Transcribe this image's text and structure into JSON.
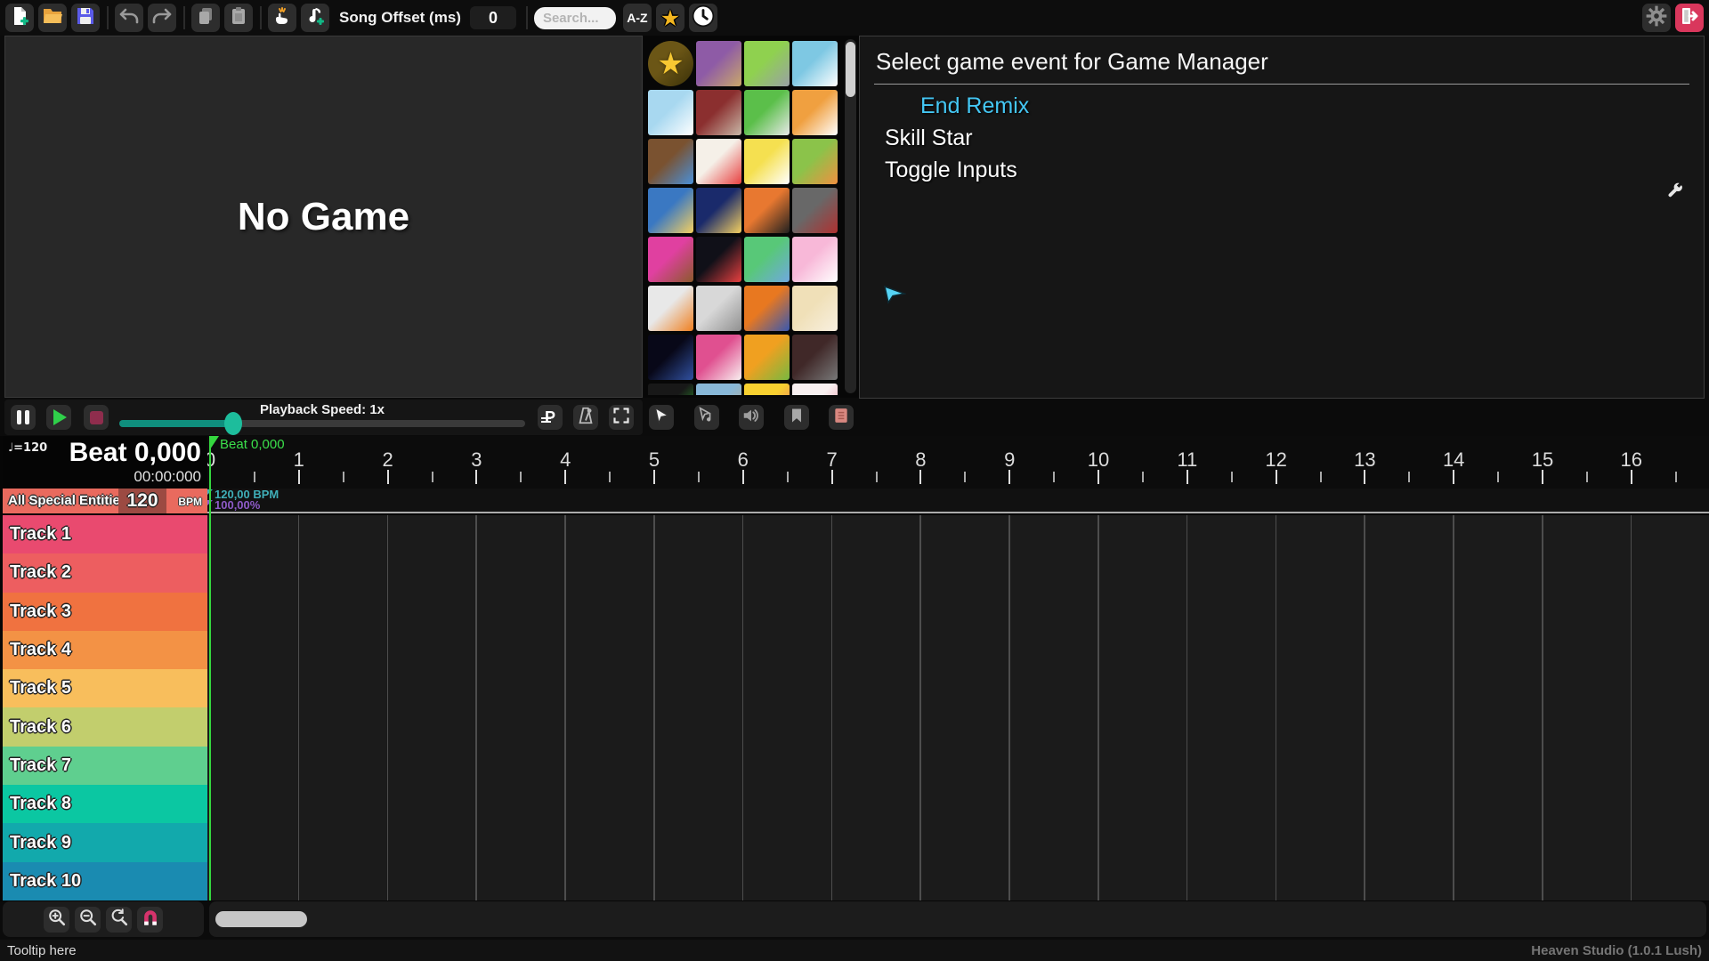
{
  "toolbar": {
    "song_offset_label": "Song Offset (ms)",
    "song_offset_value": "0",
    "search_placeholder": "Search...",
    "az_label": "A-Z",
    "star_glyph": "★"
  },
  "preview": {
    "no_game_label": "No Game"
  },
  "game_grid": {
    "selected_icon_glyph": "★",
    "icons": [
      {
        "name": "game-manager",
        "circle": true,
        "colors": [
          "#6B5616",
          "#3A3008"
        ],
        "star": true
      },
      {
        "name": "game-2",
        "colors": [
          "#8E5BA6",
          "#C9A86A"
        ]
      },
      {
        "name": "game-3",
        "colors": [
          "#8FD14F",
          "#9AA0A6"
        ]
      },
      {
        "name": "game-4",
        "colors": [
          "#7EC8E3",
          "#FFFFFF"
        ]
      },
      {
        "name": "game-5",
        "colors": [
          "#A8D8F0",
          "#FFFFFF"
        ]
      },
      {
        "name": "game-6",
        "colors": [
          "#8B2F2F",
          "#C8B8A8"
        ]
      },
      {
        "name": "game-7",
        "colors": [
          "#5BBF4A",
          "#E8E8E8"
        ]
      },
      {
        "name": "game-8",
        "colors": [
          "#F0A040",
          "#FFFFFF"
        ]
      },
      {
        "name": "game-9",
        "colors": [
          "#7A5230",
          "#4A90D9"
        ]
      },
      {
        "name": "game-10",
        "colors": [
          "#F5F0E8",
          "#E84040"
        ]
      },
      {
        "name": "game-11",
        "colors": [
          "#F5E050",
          "#FFFFFF"
        ]
      },
      {
        "name": "game-12",
        "colors": [
          "#8BC34A",
          "#F09040"
        ]
      },
      {
        "name": "game-13",
        "colors": [
          "#3A78C2",
          "#F5D060"
        ]
      },
      {
        "name": "game-14",
        "colors": [
          "#1A2A6B",
          "#F5D060"
        ]
      },
      {
        "name": "game-15",
        "colors": [
          "#E87830",
          "#202020"
        ]
      },
      {
        "name": "game-16",
        "colors": [
          "#686868",
          "#B03030"
        ]
      },
      {
        "name": "game-17",
        "colors": [
          "#E040A0",
          "#8B5A2B"
        ]
      },
      {
        "name": "game-18",
        "colors": [
          "#101018",
          "#E84040"
        ]
      },
      {
        "name": "game-19",
        "colors": [
          "#58C878",
          "#70A8E0"
        ]
      },
      {
        "name": "game-20",
        "colors": [
          "#F8B8D8",
          "#FFFFFF"
        ]
      },
      {
        "name": "game-21",
        "colors": [
          "#E8E8E8",
          "#F08020"
        ]
      },
      {
        "name": "game-22",
        "colors": [
          "#D8D8D8",
          "#909090"
        ]
      },
      {
        "name": "game-23",
        "colors": [
          "#E87820",
          "#3858B0"
        ]
      },
      {
        "name": "game-24",
        "colors": [
          "#F0E0B8",
          "#F8F0E0"
        ]
      },
      {
        "name": "game-25",
        "colors": [
          "#080818",
          "#3050A0"
        ]
      },
      {
        "name": "game-26",
        "colors": [
          "#E05090",
          "#F8F0F0"
        ]
      },
      {
        "name": "game-27",
        "colors": [
          "#F0A020",
          "#78B840"
        ]
      },
      {
        "name": "game-28",
        "colors": [
          "#402828",
          "#787878"
        ]
      },
      {
        "name": "game-29",
        "colors": [
          "#181818",
          "#30C030"
        ]
      },
      {
        "name": "game-30",
        "colors": [
          "#88B8D8",
          "#C8A878"
        ]
      },
      {
        "name": "game-31",
        "colors": [
          "#F8D030",
          "#E86078"
        ]
      },
      {
        "name": "game-32",
        "colors": [
          "#F8F0F0",
          "#E88098"
        ]
      }
    ]
  },
  "event_panel": {
    "title": "Select game event for Game Manager",
    "items": [
      {
        "label": "End Remix",
        "color": "#44C7F4",
        "indent": true
      },
      {
        "label": "Skill Star",
        "color": "#FFFFFF",
        "indent": false
      },
      {
        "label": "Toggle Inputs",
        "color": "#FFFFFF",
        "indent": false
      }
    ]
  },
  "playback": {
    "speed_label": "Playback Speed: 1x"
  },
  "timeline": {
    "tempo_note": "♩=120",
    "beat_display": "Beat 0,000",
    "time_display": "00:00:000",
    "special_entities_label": "All Special Entities",
    "bpm_value": "120",
    "bpm_unit": "BPM",
    "playhead_label": "Beat 0,000",
    "bpm_marker": "120,00 BPM",
    "volume_marker": "100,00%",
    "beat_numbers": [
      "0",
      "1",
      "2",
      "3",
      "4",
      "5",
      "6",
      "7",
      "8",
      "9",
      "10",
      "11",
      "12",
      "13",
      "14",
      "15",
      "16"
    ],
    "beat_spacing_px": 99.8,
    "tracks": [
      {
        "label": "Track 1",
        "color": "#E94A6F"
      },
      {
        "label": "Track 2",
        "color": "#ED5E60"
      },
      {
        "label": "Track 3",
        "color": "#F07240"
      },
      {
        "label": "Track 4",
        "color": "#F39245"
      },
      {
        "label": "Track 5",
        "color": "#F8BE5C"
      },
      {
        "label": "Track 6",
        "color": "#C2CE6D"
      },
      {
        "label": "Track 7",
        "color": "#5FCF8F"
      },
      {
        "label": "Track 8",
        "color": "#0BC7A2"
      },
      {
        "label": "Track 9",
        "color": "#12A9AC"
      },
      {
        "label": "Track 10",
        "color": "#1A8BB1"
      }
    ]
  },
  "status_bar": {
    "tooltip": "Tooltip here",
    "version": "Heaven Studio (1.0.1 Lush)"
  }
}
